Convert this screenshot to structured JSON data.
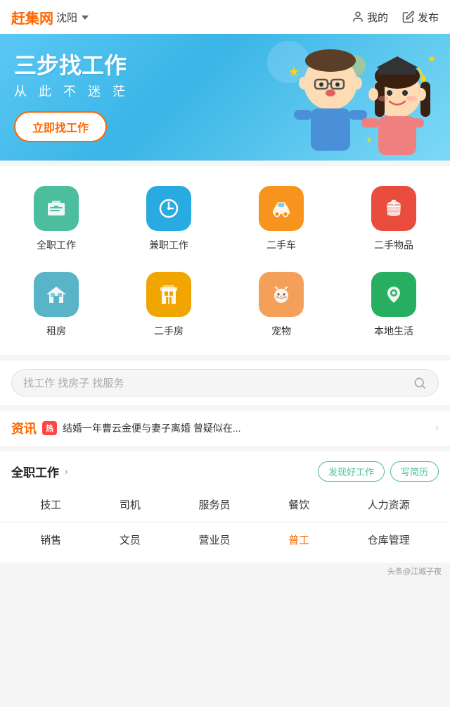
{
  "header": {
    "logo": "赶集网",
    "city": "沈阳",
    "my_label": "我的",
    "publish_label": "发布"
  },
  "banner": {
    "title": "三步找工作",
    "subtitle": "从 此 不 迷 茫",
    "cta": "立即找工作"
  },
  "categories": [
    {
      "id": "fulltime",
      "label": "全职工作",
      "icon": "💼",
      "bg": "bg-green"
    },
    {
      "id": "parttime",
      "label": "兼职工作",
      "icon": "⏰",
      "bg": "bg-blue"
    },
    {
      "id": "usedcar",
      "label": "二手车",
      "icon": "🚗",
      "bg": "bg-orange"
    },
    {
      "id": "usedgoods",
      "label": "二手物品",
      "icon": "🧺",
      "bg": "bg-red"
    },
    {
      "id": "rental",
      "label": "租房",
      "icon": "🏠",
      "bg": "bg-teal"
    },
    {
      "id": "usedhouse",
      "label": "二手房",
      "icon": "🏢",
      "bg": "bg-amber"
    },
    {
      "id": "pet",
      "label": "宠物",
      "icon": "🐱",
      "bg": "bg-pink"
    },
    {
      "id": "local",
      "label": "本地生活",
      "icon": "📍",
      "bg": "bg-emerald"
    }
  ],
  "search": {
    "placeholder": "找工作 找房子 找服务"
  },
  "news": {
    "label": "资讯",
    "hot_badge": "热",
    "text": "结婚一年曹云金便与妻子离婚 曾疑似在..."
  },
  "jobs": {
    "section_title": "全职工作",
    "more_label": "›",
    "btn_discover": "发现好工作",
    "btn_resume": "写简历",
    "tags_row1": [
      {
        "label": "技工",
        "active": false
      },
      {
        "label": "司机",
        "active": false
      },
      {
        "label": "服务员",
        "active": false
      },
      {
        "label": "餐饮",
        "active": false
      },
      {
        "label": "人力资源",
        "active": false
      }
    ],
    "tags_row2": [
      {
        "label": "销售",
        "active": false
      },
      {
        "label": "文员",
        "active": false
      },
      {
        "label": "营业员",
        "active": false
      },
      {
        "label": "普工",
        "active": true
      },
      {
        "label": "仓库管理",
        "active": false
      }
    ]
  },
  "watermark": "头条@江城子夜"
}
